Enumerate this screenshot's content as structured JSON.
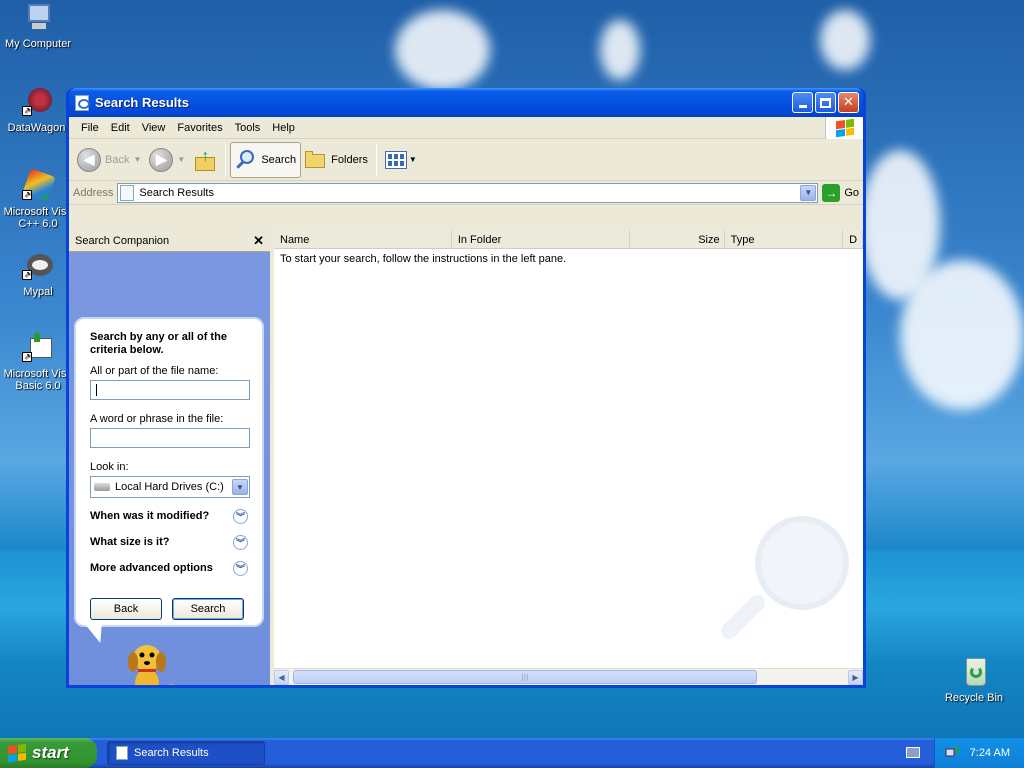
{
  "desktop": {
    "icons": [
      {
        "label": "My Computer"
      },
      {
        "label": "DataWagon."
      },
      {
        "label": "Microsoft Visu C++ 6.0"
      },
      {
        "label": "Mypal"
      },
      {
        "label": "Microsoft Visu Basic 6.0"
      },
      {
        "label": "Recycle Bin"
      }
    ]
  },
  "window": {
    "title": "Search Results",
    "menu": [
      "File",
      "Edit",
      "View",
      "Favorites",
      "Tools",
      "Help"
    ],
    "toolbar": {
      "back": "Back",
      "search": "Search",
      "folders": "Folders"
    },
    "address": {
      "label": "Address",
      "value": "Search Results",
      "go": "Go"
    }
  },
  "search_companion": {
    "title": "Search Companion",
    "heading": "Search by any or all of the criteria below.",
    "file_name_label": "All or part of the file name:",
    "file_name_value": "",
    "phrase_label": "A word or phrase in the file:",
    "phrase_value": "",
    "look_in_label": "Look in:",
    "look_in_value": "Local Hard Drives (C:)",
    "expanders": [
      "When was it modified?",
      "What size is it?",
      "More advanced options"
    ],
    "back_button": "Back",
    "search_button": "Search"
  },
  "results": {
    "columns": [
      "Name",
      "In Folder",
      "Size",
      "Type",
      "D"
    ],
    "message": "To start your search, follow the instructions in the left pane."
  },
  "taskbar": {
    "start": "start",
    "task_item": "Search Results",
    "clock": "7:24 AM"
  },
  "colors": {
    "title_blue": "#0553e0",
    "start_green": "#31922f",
    "companion_blue": "#7b97e0"
  }
}
